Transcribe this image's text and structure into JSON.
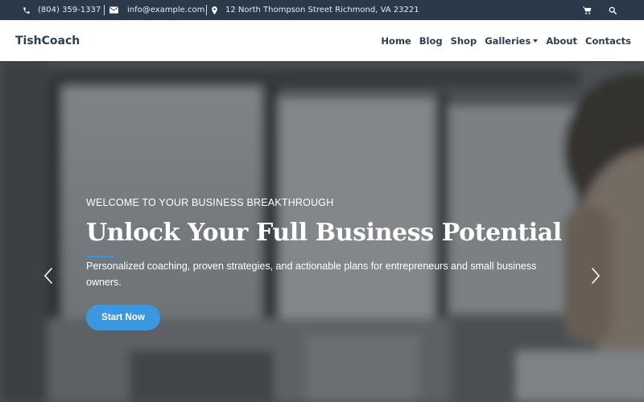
{
  "topbar": {
    "phone": "(804) 359-1337",
    "email": "info@example.com",
    "address": "12 North Thompson Street Richmond, VA 23221",
    "icons": [
      "phone-icon",
      "envelope-icon",
      "map-marker-icon",
      "cart-icon",
      "search-icon"
    ]
  },
  "nav": {
    "brand": "TishCoach",
    "items": [
      {
        "label": "Home"
      },
      {
        "label": "Blog"
      },
      {
        "label": "Shop"
      },
      {
        "label": "Galleries"
      },
      {
        "label": "About"
      },
      {
        "label": "Contacts"
      }
    ]
  },
  "hero": {
    "eyebrow": "WELCOME TO YOUR BUSINESS BREAKTHROUGH",
    "title": "Unlock Your Full Business Potential",
    "subtitle": "Personalized coaching, proven strategies, and actionable plans for entrepreneurs and small business owners.",
    "cta": "Start Now",
    "prev_icon": "chevron-left-icon",
    "next_icon": "chevron-right-icon"
  },
  "colors": {
    "topbar_bg": "#2a3a4b",
    "accent": "#3a97e0",
    "nav_text": "#2c3e50"
  }
}
